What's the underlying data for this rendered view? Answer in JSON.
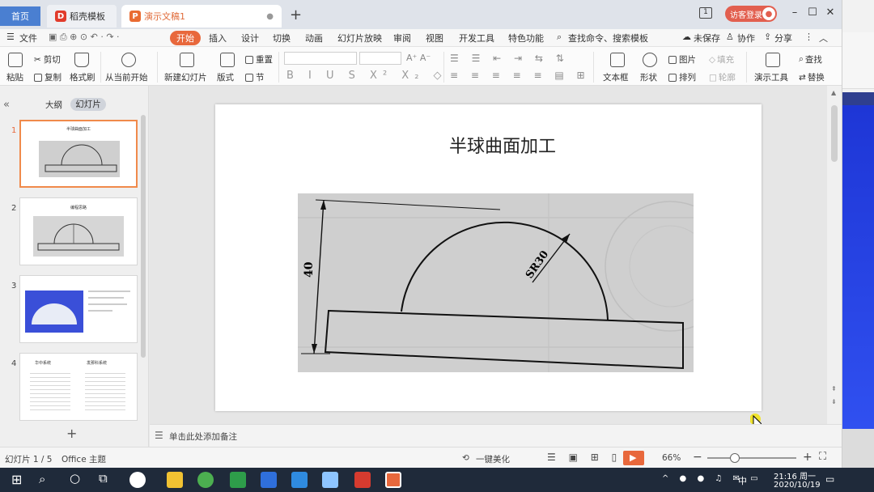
{
  "tabs": {
    "home": "首页",
    "template": "稻壳模板",
    "document": "演示文稿1",
    "new_tab_symbol": "+"
  },
  "header": {
    "login": "访客登录",
    "badge": "1"
  },
  "menu": {
    "file": "文件",
    "items": [
      "开始",
      "插入",
      "设计",
      "切换",
      "动画",
      "幻灯片放映",
      "审阅",
      "视图",
      "开发工具",
      "特色功能"
    ],
    "search": "查找命令、搜索模板",
    "unsaved": "未保存",
    "collab": "协作",
    "share": "分享"
  },
  "ribbon": {
    "paste": "粘贴",
    "cut": "剪切",
    "copy": "复制",
    "format_painter": "格式刷",
    "play_from_current": "从当前开始",
    "new_slide": "新建幻灯片",
    "layout": "版式",
    "reset": "重置",
    "section": "节",
    "textbox": "文本框",
    "shape": "形状",
    "arrange": "排列",
    "picture": "图片",
    "fill": "填充",
    "outline": "轮廓",
    "present_tools": "演示工具",
    "find": "查找",
    "replace": "替换"
  },
  "panel": {
    "outline_tab": "大纲",
    "slides_tab": "幻灯片",
    "collapse": "«",
    "add_symbol": "+",
    "thumbs": [
      {
        "num": "1",
        "title": "半球曲面加工"
      },
      {
        "num": "2",
        "title": "编程思路"
      },
      {
        "num": "3",
        "title": ""
      },
      {
        "num": "4",
        "col1": "华中系统",
        "col2": "发那科系统"
      }
    ]
  },
  "slide": {
    "title": "半球曲面加工",
    "dim_height": "40",
    "dim_radius": "SR30"
  },
  "notes": {
    "placeholder": "单击此处添加备注"
  },
  "status": {
    "slide_index": "幻灯片 1 / 5",
    "theme": "Office 主题",
    "beautify": "一键美化",
    "zoom": "66%"
  },
  "taskbar": {
    "time": "21:16 周一",
    "date": "2020/10/19",
    "ime": "中"
  },
  "colors": {
    "accent": "#e8683c",
    "home_tab": "#4a7fd1",
    "login": "#e25f4f",
    "taskbar": "#1f2a3a"
  }
}
